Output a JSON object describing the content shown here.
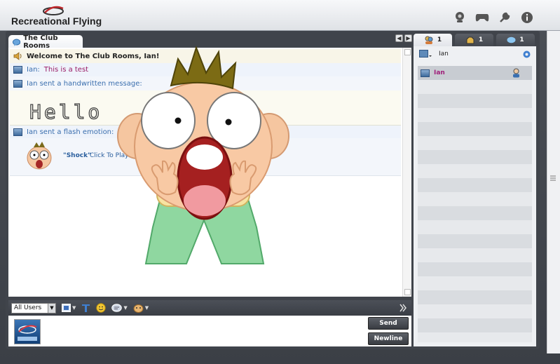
{
  "app": {
    "title": "Recreational Flying"
  },
  "header": {
    "icons": [
      "webcam-icon",
      "games-icon",
      "tools-icon",
      "info-icon"
    ]
  },
  "chat": {
    "tab_label": "The Club Rooms",
    "welcome": "Welcome to The Club Rooms, Ian!",
    "test_sender": "Ian:",
    "test_text": "This is a test",
    "handwritten_notice": "Ian sent a handwritten message:",
    "handwritten_text": "Hello",
    "flash_notice": "Ian sent a flash emotion:",
    "flash_name": "\"Shock\"",
    "flash_action": "Click To Play"
  },
  "input": {
    "users_select": "All Users",
    "send_label": "Send",
    "newline_label": "Newline"
  },
  "users_panel": {
    "tabs": [
      {
        "icon": "users-icon",
        "count": "1"
      },
      {
        "icon": "hand-icon",
        "count": "1"
      },
      {
        "icon": "chat-bubble-icon",
        "count": "1"
      }
    ],
    "current_user": "Ian",
    "list": [
      {
        "name": "Ian",
        "selected": true
      }
    ]
  },
  "colors": {
    "accent": "#3b6fae",
    "user_text": "#a0207a",
    "frame": "#40444b"
  }
}
